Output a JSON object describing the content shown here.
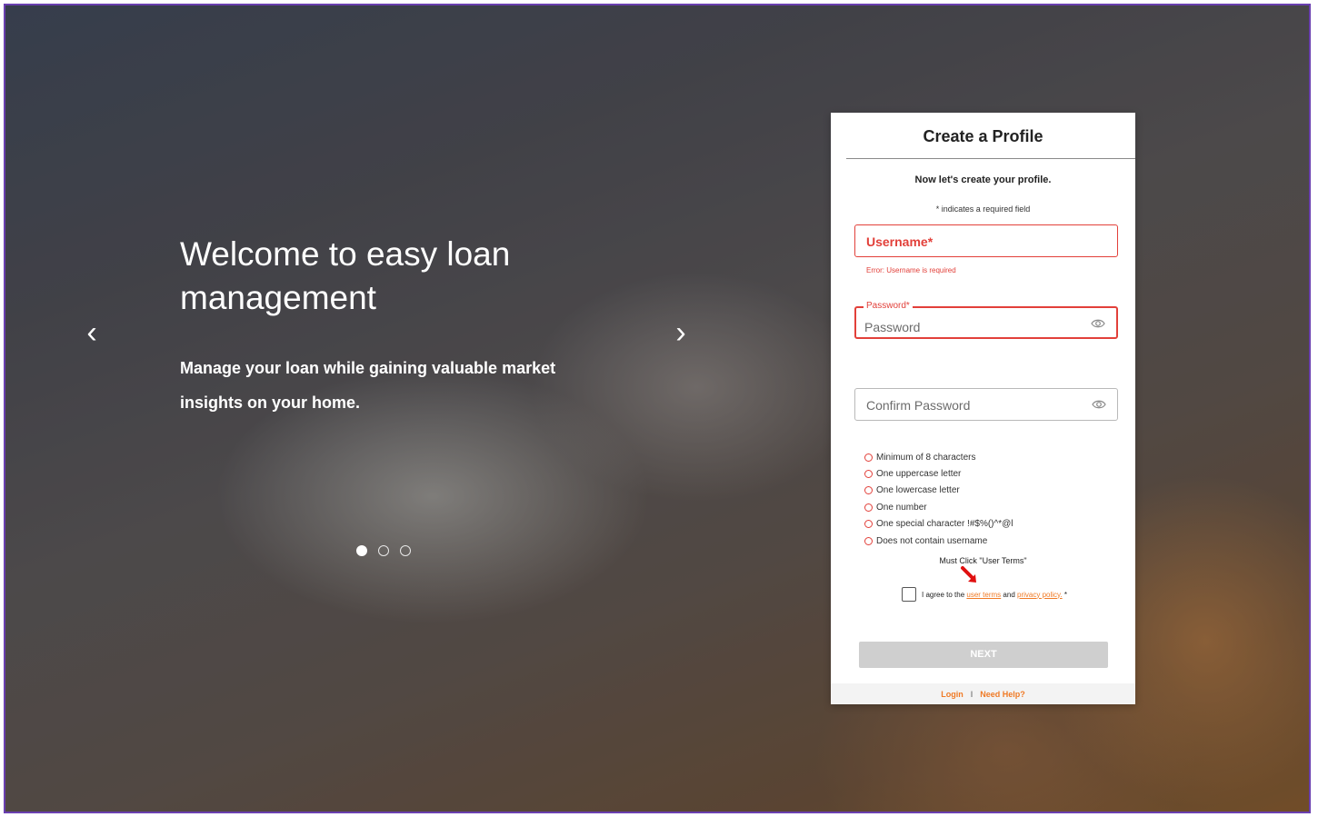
{
  "hero": {
    "title": "Welcome to easy loan management",
    "subtitle": "Manage your loan while gaining valuable market insights on your home.",
    "prev_icon": "chevron-left-icon",
    "next_icon": "chevron-right-icon",
    "prev_glyph": "‹",
    "next_glyph": "›",
    "slide_count": 3,
    "active_slide": 1
  },
  "card": {
    "title": "Create a Profile",
    "lead": "Now let's create your profile.",
    "required_note": "* indicates a required field",
    "username": {
      "label": "Username*",
      "error": "Error: Username is required"
    },
    "password": {
      "float_label": "Password*",
      "placeholder": "Password",
      "toggle_icon": "eye-icon"
    },
    "confirm_password": {
      "placeholder": "Confirm Password",
      "toggle_icon": "eye-icon"
    },
    "rules": [
      "Minimum of 8 characters",
      "One uppercase letter",
      "One lowercase letter",
      "One number",
      "One special character !#$%()^*@l",
      "Does not contain username"
    ],
    "must_click": "Must Click \"User Terms\"",
    "agree": {
      "prefix": "I agree to the",
      "user_terms": "user terms",
      "and": "and",
      "privacy": "privacy policy.",
      "required_mark": "*"
    },
    "next_label": "NEXT",
    "footer": {
      "login": "Login",
      "separator": "I",
      "help": "Need Help?"
    }
  },
  "colors": {
    "accent_orange": "#f07a25",
    "error_red": "#e2403a",
    "frame_purple": "#6a3fb0",
    "button_disabled": "#cfcfcf"
  }
}
